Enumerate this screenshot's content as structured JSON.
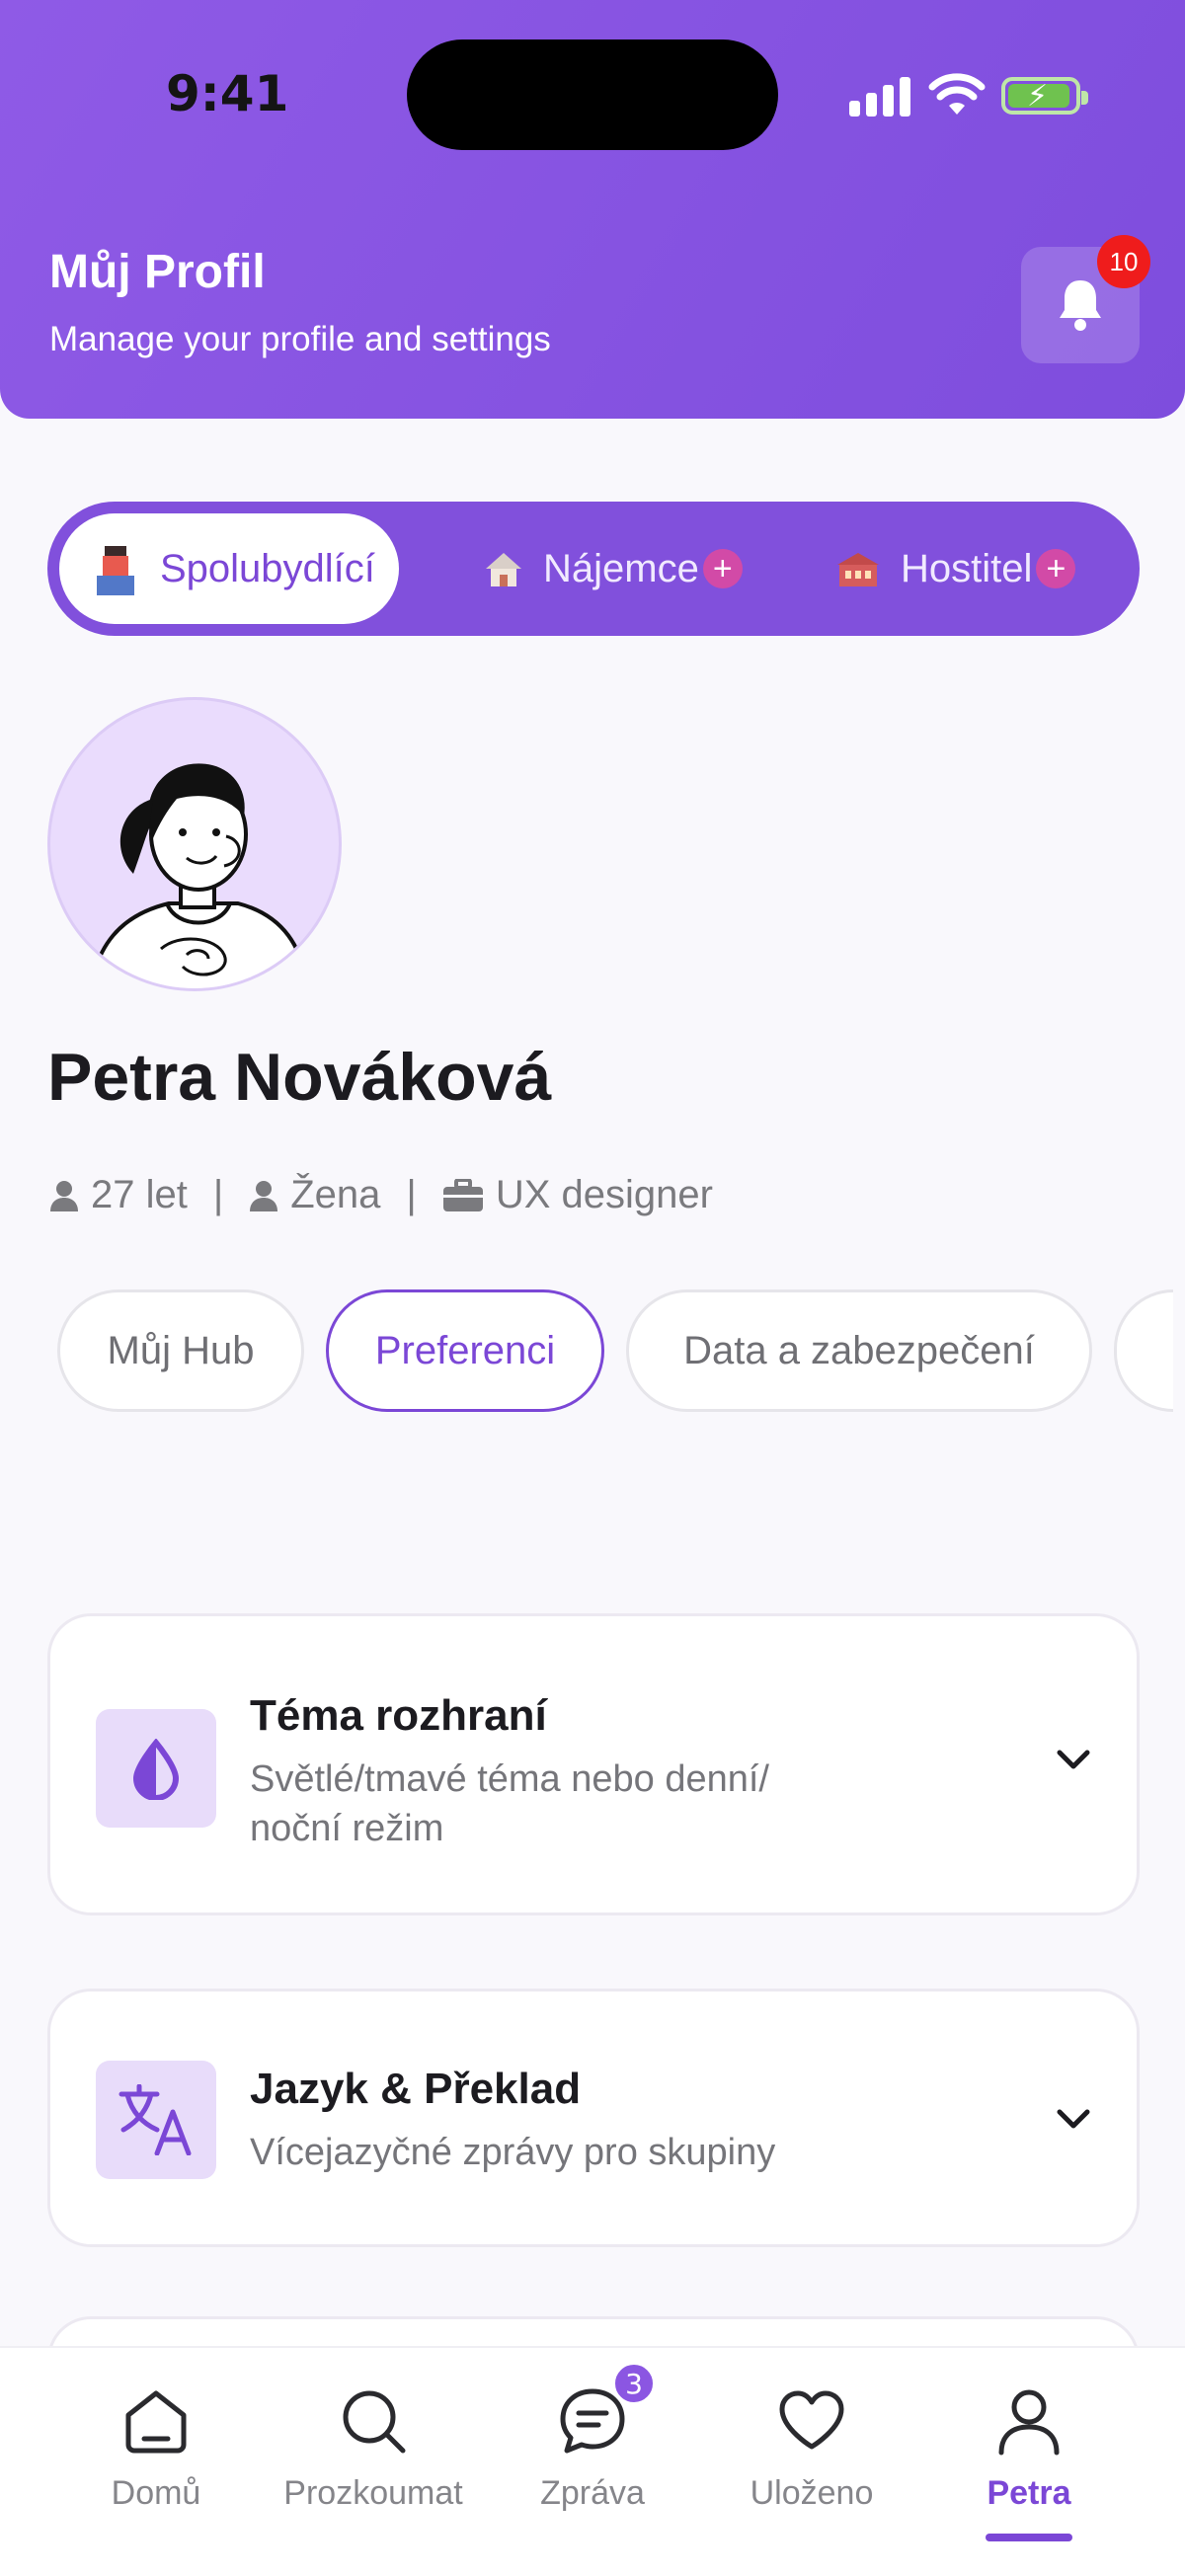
{
  "status_bar": {
    "time": "9:41"
  },
  "header": {
    "title": "Můj Profil",
    "subtitle": "Manage your profile and settings",
    "notification_count": "10"
  },
  "roles": [
    {
      "label": "Spolubydlící",
      "icon": "roommate-emoji"
    },
    {
      "label": "Nájemce",
      "icon": "house-emoji"
    },
    {
      "label": "Hostitel",
      "icon": "host-emoji"
    }
  ],
  "profile": {
    "name": "Petra Nováková",
    "age": "27 let",
    "gender": "Žena",
    "job": "UX designer",
    "separator": "|"
  },
  "tabs": [
    "Můj Hub",
    "Preferenci",
    "Data a zabezpečení"
  ],
  "active_tab": "Preferenci",
  "settings": [
    {
      "title": "Téma rozhraní",
      "description": "Světlé/tmavé téma nebo denní/ noční režim",
      "icon": "droplet-half-icon"
    },
    {
      "title": "Jazyk & Překlad",
      "description": "Vícejazyčné zprávy pro skupiny",
      "icon": "translate-icon"
    }
  ],
  "nav": {
    "items": [
      "Domů",
      "Prozkoumat",
      "Zpráva",
      "Uloženo",
      "Petra"
    ],
    "messages_badge": "3",
    "active": "Petra"
  },
  "colors": {
    "accent": "#7b47d6",
    "header": "#8553df",
    "badge_red": "#ef1c1c"
  }
}
